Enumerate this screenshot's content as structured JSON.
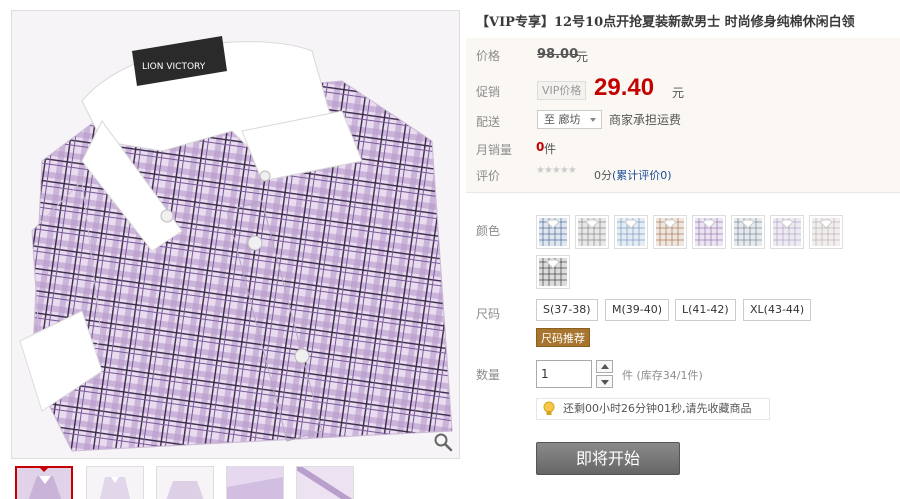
{
  "product": {
    "title": "【VIP专享】12号10点开抢夏装新款男士 时尚修身纯棉休闲白领",
    "brand_logo": "LION VICTORY"
  },
  "labels": {
    "price": "价格",
    "promo": "促销",
    "shipping": "配送",
    "monthly_sales": "月销量",
    "rating": "评价",
    "color": "颜色",
    "size": "尺码",
    "quantity": "数量"
  },
  "pricing": {
    "original": "98.00",
    "currency": "元",
    "vip_tag": "VIP价格",
    "promo_price": "29.40"
  },
  "shipping": {
    "destination": "至 廊坊",
    "note": "商家承担运费"
  },
  "sales": {
    "count": "0",
    "unit": "件"
  },
  "rating": {
    "stars": "★★★★★",
    "score": "0分",
    "link": "(累计评价0)"
  },
  "colors": [
    {
      "name": "blue-plaid",
      "base": "#dfe6f0",
      "line": "#3a5a8a"
    },
    {
      "name": "grey-plaid",
      "base": "#e8e8e8",
      "line": "#7a7a7a"
    },
    {
      "name": "light-blue",
      "base": "#e4ecf4",
      "line": "#6f8fb8"
    },
    {
      "name": "brown-plaid",
      "base": "#efe6df",
      "line": "#9a6a4a"
    },
    {
      "name": "purple-plaid",
      "base": "#ece4f0",
      "line": "#8a6aa8"
    },
    {
      "name": "grey-blue",
      "base": "#e6eaee",
      "line": "#6a7a8a"
    },
    {
      "name": "lavender",
      "base": "#eeeaf2",
      "line": "#a89abc"
    },
    {
      "name": "pale-plaid",
      "base": "#f0eeee",
      "line": "#b8aaa8"
    },
    {
      "name": "dark-plaid",
      "base": "#dcdcdc",
      "line": "#2a2a2a"
    }
  ],
  "sizes": [
    "S(37-38)",
    "M(39-40)",
    "L(41-42)",
    "XL(43-44)"
  ],
  "size_guide": "尺码推荐",
  "quantity": {
    "value": "1",
    "stock_text": "件 (库存34/1件)"
  },
  "countdown": "还剩00小时26分钟01秒,请先收藏商品",
  "start_button": "即将开始",
  "colors_theme": {
    "price_red": "#c40000",
    "panel_bg": "#fbf8f3",
    "button_grey": "#707070"
  }
}
